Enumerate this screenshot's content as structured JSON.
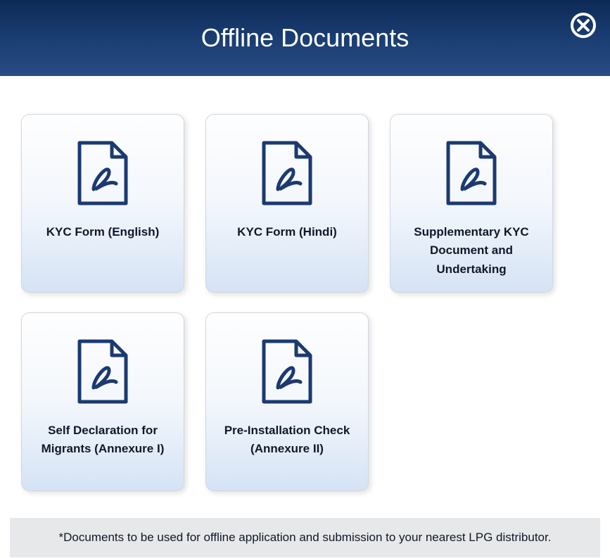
{
  "title": "Offline Documents",
  "cards": [
    {
      "label": "KYC Form (English)"
    },
    {
      "label": "KYC Form (Hindi)"
    },
    {
      "label": "Supplementary KYC Document\nand Undertaking"
    },
    {
      "label": "Self Declaration for Migrants (Annexure I)"
    },
    {
      "label": "Pre-Installation Check (Annexure II)"
    }
  ],
  "footnote": "*Documents to be used for offline application and submission to your nearest LPG distributor."
}
